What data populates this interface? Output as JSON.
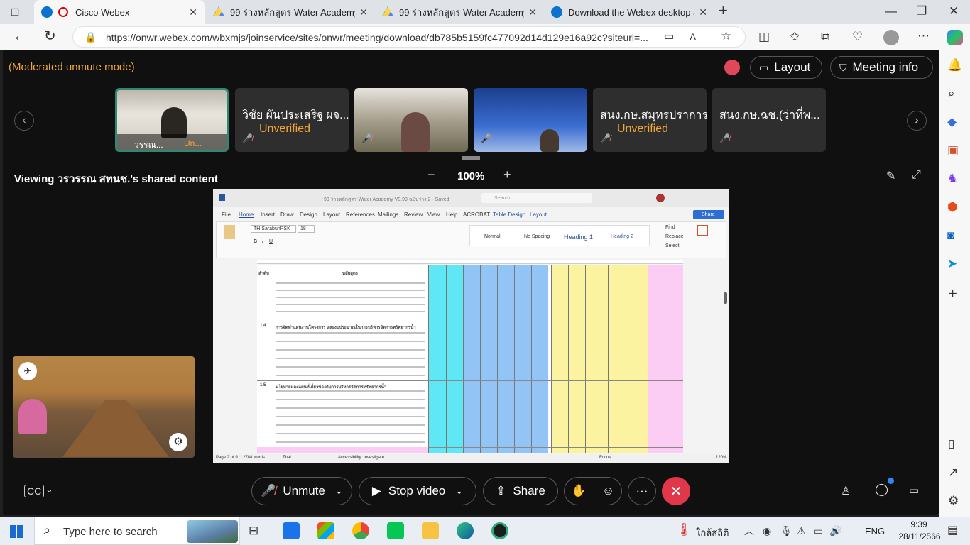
{
  "browser": {
    "tabs": [
      {
        "title": "Cisco Webex",
        "active": true
      },
      {
        "title": "99 ร่างหลักสูตร Water Academy V0",
        "active": false
      },
      {
        "title": "99 ร่างหลักสูตร Water Academy V0",
        "active": false
      },
      {
        "title": "Download the Webex desktop ar",
        "active": false
      }
    ],
    "url": "https://onwr.webex.com/wbxmjs/joinservice/sites/onwr/meeting/download/db785b5159fc477092d14d129e16a92c?siteurl=..."
  },
  "webex": {
    "mode_text": "(Moderated unmute mode)",
    "layout_label": "Layout",
    "meeting_info_label": "Meeting info",
    "participants": [
      {
        "name": "วรรณ...",
        "status": "Un..."
      },
      {
        "name": "วิชัย ผันประเสริฐ ผจ...",
        "status": "Unverified"
      },
      {
        "name": "",
        "status": ""
      },
      {
        "name": "",
        "status": ""
      },
      {
        "name": "สนง.กษ.สมุทรปราการ",
        "status": "Unverified"
      },
      {
        "name": "สนง.กษ.ฉช.(ว่าที่พ...",
        "status": ""
      }
    ],
    "viewing_text": "Viewing วรวรรณ สทนช.'s shared content",
    "zoom_level": "100%",
    "controls": {
      "unmute": "Unmute",
      "stop_video": "Stop video",
      "share": "Share"
    }
  },
  "document": {
    "title_bar": "99 ร่างหลักสูตร Water Academy V0.99 ฉบับร่าง 2 - Saved",
    "search_placeholder": "Search",
    "menu": [
      "File",
      "Home",
      "Insert",
      "Draw",
      "Design",
      "Layout",
      "References",
      "Mailings",
      "Review",
      "View",
      "Help",
      "ACROBAT",
      "Table Design",
      "Layout"
    ],
    "share_label": "Share",
    "font_name": "TH SarabunPSK",
    "font_size": "18",
    "styles": [
      "Normal",
      "No Spacing",
      "Heading 1",
      "Heading 2"
    ],
    "editing": [
      "Find",
      "Replace",
      "Select"
    ],
    "status_bar": {
      "page": "Page 2 of 9",
      "words": "2788 words",
      "lang": "Thai",
      "accessibility": "Accessibility: Investigate",
      "focus": "Focus",
      "zoom": "120%"
    },
    "table": {
      "header_no": "ลำดับ",
      "header_course": "หลักสูตร",
      "sections": [
        {
          "no": "",
          "title": ""
        },
        {
          "no": "1.4",
          "title": "การจัดทำแผนงานโครงการ และงบประมาณในการบริหารจัดการทรัพยากรน้ำ"
        },
        {
          "no": "1.5",
          "title": "นโยบายและแผนที่เกี่ยวข้องกับการบริหารจัดการทรัพยากรน้ำ"
        }
      ]
    }
  },
  "taskbar": {
    "search_placeholder": "Type here to search",
    "weather": "ใกล้สถิติ",
    "lang": "ENG",
    "time": "9:39",
    "date": "28/11/2566"
  }
}
